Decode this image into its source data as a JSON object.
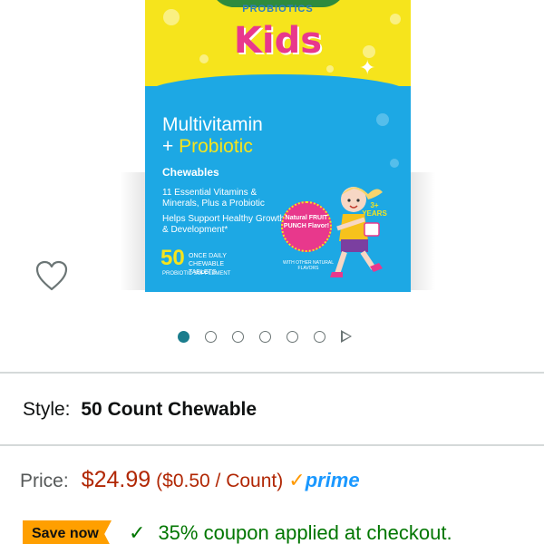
{
  "product_image": {
    "brand_line": "PROBIOTICS",
    "kids": "Kids",
    "title_line1": "Multivitamin",
    "title_plus": "+",
    "title_line2": "Probiotic",
    "form": "Chewables",
    "claim1": "11 Essential Vitamins & Minerals, Plus a Probiotic",
    "claim2": "Helps Support Healthy Growth & Development*",
    "count_number": "50",
    "count_text": "ONCE DAILY CHEWABLE TABLETS",
    "supplement": "PROBIOTIC SUPPLEMENT",
    "flavor_badge": "Natural FRUIT PUNCH Flavor!",
    "age_badge": "3+ YEARS",
    "other_flavors": "WITH OTHER NATURAL FLAVORS"
  },
  "wishlist": {
    "icon": "heart-outline-icon"
  },
  "carousel": {
    "dot_count": 6,
    "active_index": 0
  },
  "style": {
    "label": "Style:",
    "value": "50 Count Chewable"
  },
  "price": {
    "label": "Price:",
    "value": "$24.99",
    "unit_price": "($0.50 / Count)",
    "prime_check": "✓",
    "prime_text": "prime"
  },
  "coupon": {
    "badge": "Save now",
    "check": "✓",
    "text": "35% coupon applied at checkout."
  },
  "colors": {
    "price_red": "#b12704",
    "prime_blue": "#1a98ff",
    "save_orange": "#ff9f00",
    "coupon_green": "#007600",
    "carousel_active": "#1b7d8d"
  }
}
